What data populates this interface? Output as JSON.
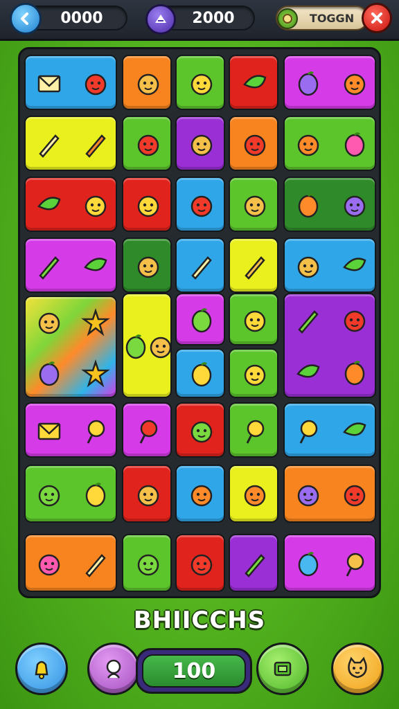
{
  "hud": {
    "coins": "0000",
    "score": "2000",
    "token_label": "TOGGN"
  },
  "icons": {
    "back": "back-arrow-icon",
    "gem": "gem-icon",
    "token": "token-icon",
    "close": "close-icon"
  },
  "game_title": "BHIICCHS",
  "moves_counter": "100",
  "bottom_buttons": [
    {
      "name": "bell-button",
      "icon": "bell-icon",
      "color": "#2e8fe0"
    },
    {
      "name": "character-button",
      "icon": "character-icon",
      "color": "#b05cc8"
    },
    {
      "name": "shop-button",
      "icon": "shop-icon",
      "color": "#55c42a"
    },
    {
      "name": "pet-button",
      "icon": "cat-icon",
      "color": "#f2a51c"
    }
  ],
  "colors": {
    "blue": "#2fa6e8",
    "orange": "#f7841e",
    "green": "#5cc52c",
    "red": "#e0231c",
    "magenta": "#d63be8",
    "yellow": "#eaf01e",
    "purple": "#9a2fd6",
    "darkgreen": "#2f8a2a",
    "rainbow": "#7fd63a"
  },
  "tiles": [
    {
      "color": "blue",
      "icons": [
        "box-icon",
        "cat-face-icon"
      ]
    },
    {
      "color": "orange",
      "icons": [
        "bunny-face-icon"
      ]
    },
    {
      "color": "green",
      "icons": [
        "monkey-face-icon"
      ]
    },
    {
      "color": "red",
      "icons": [
        "leaf-icon"
      ]
    },
    {
      "color": "magenta",
      "icons": [
        "potion-icon",
        "fox-face-icon"
      ]
    },
    {
      "color": "yellow",
      "icons": [
        "pencil-icon",
        "torch-icon"
      ]
    },
    {
      "color": "green",
      "icons": [
        "goblin-face-icon"
      ]
    },
    {
      "color": "purple",
      "icons": [
        "fruit-face-icon"
      ]
    },
    {
      "color": "orange",
      "icons": [
        "ghost-icon"
      ]
    },
    {
      "color": "green",
      "icons": [
        "chick-icon",
        "plum-icon"
      ]
    },
    {
      "color": "red",
      "icons": [
        "leaf-icon",
        "sprout-face-icon"
      ]
    },
    {
      "color": "red",
      "icons": [
        "radish-face-icon"
      ]
    },
    {
      "color": "blue",
      "icons": [
        "orange-face-icon"
      ]
    },
    {
      "color": "green",
      "icons": [
        "apple-face-icon"
      ]
    },
    {
      "color": "darkgreen",
      "icons": [
        "icecream-icon",
        "lion-face-icon"
      ]
    },
    {
      "color": "magenta",
      "icons": [
        "pencil-icon",
        "lime-icon"
      ]
    },
    {
      "color": "darkgreen",
      "icons": [
        "acorn-face-icon"
      ]
    },
    {
      "color": "blue",
      "icons": [
        "hammer-icon"
      ]
    },
    {
      "color": "yellow",
      "icons": [
        "wand-icon"
      ]
    },
    {
      "color": "blue",
      "icons": [
        "grape-face-icon",
        "lime-icon"
      ]
    },
    {
      "color": "rainbow",
      "icons": [
        "rooster-icon",
        "star-icon",
        "turnip-icon",
        "star-icon"
      ]
    },
    {
      "color": "yellow",
      "icons": [
        "bottle-icon",
        "onion-face-icon"
      ]
    },
    {
      "color": "magenta",
      "icons": [
        "cup-icon"
      ]
    },
    {
      "color": "green",
      "icons": [
        "tomato-face-icon"
      ]
    },
    {
      "color": "purple",
      "icons": [
        "pencil-icon",
        "cat-face-icon",
        "avocado-icon",
        "flame-icon"
      ]
    },
    {
      "color": "blue",
      "icons": [
        "lemon-icon"
      ]
    },
    {
      "color": "green",
      "icons": [
        "orange-face-icon"
      ]
    },
    {
      "color": "magenta",
      "icons": [
        "envelope-icon",
        "watch-icon"
      ]
    },
    {
      "color": "magenta",
      "icons": [
        "lollipop-icon"
      ]
    },
    {
      "color": "red",
      "icons": [
        "frog-face-icon"
      ]
    },
    {
      "color": "green",
      "icons": [
        "lollipop-icon"
      ]
    },
    {
      "color": "blue",
      "icons": [
        "candy-icon",
        "leaf-icon"
      ]
    },
    {
      "color": "green",
      "icons": [
        "lion-face-icon",
        "icecream-icon"
      ]
    },
    {
      "color": "red",
      "icons": [
        "bird-icon"
      ]
    },
    {
      "color": "blue",
      "icons": [
        "cowboy-face-icon"
      ]
    },
    {
      "color": "yellow",
      "icons": [
        "cat-face-icon"
      ]
    },
    {
      "color": "orange",
      "icons": [
        "fish-face-icon",
        "cat-face-icon"
      ]
    },
    {
      "color": "orange",
      "icons": [
        "duck-icon",
        "pencil-icon"
      ]
    },
    {
      "color": "green",
      "icons": [
        "bear-face-icon"
      ]
    },
    {
      "color": "red",
      "icons": [
        "orange-face-icon"
      ]
    },
    {
      "color": "purple",
      "icons": [
        "axe-icon"
      ]
    },
    {
      "color": "magenta",
      "icons": [
        "plum-icon",
        "ring-icon"
      ]
    }
  ]
}
